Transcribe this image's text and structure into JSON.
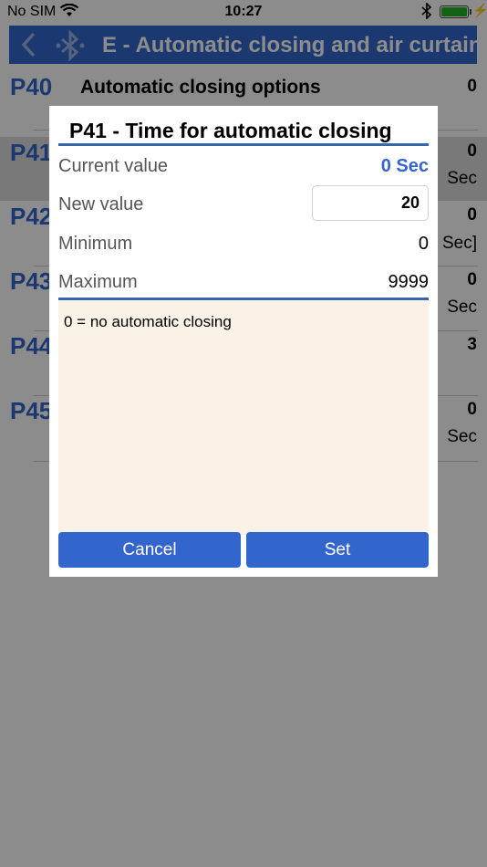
{
  "status_bar": {
    "carrier": "No SIM",
    "time": "10:27",
    "battery_level": 1.0
  },
  "nav": {
    "back_icon": "chevron-left-icon",
    "device_icon": "bluetooth-icon",
    "title": "E - Automatic closing and air curtain"
  },
  "params": [
    {
      "code": "P40",
      "name": "Automatic closing options",
      "value": "0",
      "unit": ""
    },
    {
      "code": "P41",
      "name": "",
      "value": "0",
      "unit": "Sec"
    },
    {
      "code": "P42",
      "name": "",
      "value": "0",
      "unit": "Sec]"
    },
    {
      "code": "P43",
      "name": "",
      "value": "0",
      "unit": "Sec"
    },
    {
      "code": "P44",
      "name": "",
      "value": "3",
      "unit": ""
    },
    {
      "code": "P45",
      "name": "",
      "value": "0",
      "unit": "Sec"
    }
  ],
  "dialog": {
    "title": "P41 - Time for automatic closing",
    "current_label": "Current value",
    "current_value": "0 Sec",
    "new_label": "New value",
    "new_value": "20",
    "min_label": "Minimum",
    "min_value": "0",
    "max_label": "Maximum",
    "max_value": "9999",
    "description": "0 = no automatic closing",
    "cancel_label": "Cancel",
    "set_label": "Set"
  },
  "colors": {
    "accent": "#3366cc",
    "description_bg": "#faf1e7",
    "battery": "#23b323"
  }
}
